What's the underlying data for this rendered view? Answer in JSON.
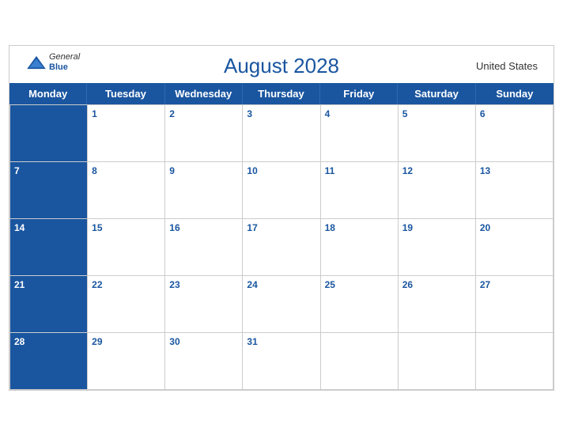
{
  "header": {
    "logo": {
      "general": "General",
      "blue": "Blue"
    },
    "title": "August 2028",
    "country": "United States"
  },
  "days_of_week": [
    "Monday",
    "Tuesday",
    "Wednesday",
    "Thursday",
    "Friday",
    "Saturday",
    "Sunday"
  ],
  "weeks": [
    [
      null,
      1,
      2,
      3,
      4,
      5,
      6
    ],
    [
      7,
      8,
      9,
      10,
      11,
      12,
      13
    ],
    [
      14,
      15,
      16,
      17,
      18,
      19,
      20
    ],
    [
      21,
      22,
      23,
      24,
      25,
      26,
      27
    ],
    [
      28,
      29,
      30,
      31,
      null,
      null,
      null
    ]
  ]
}
